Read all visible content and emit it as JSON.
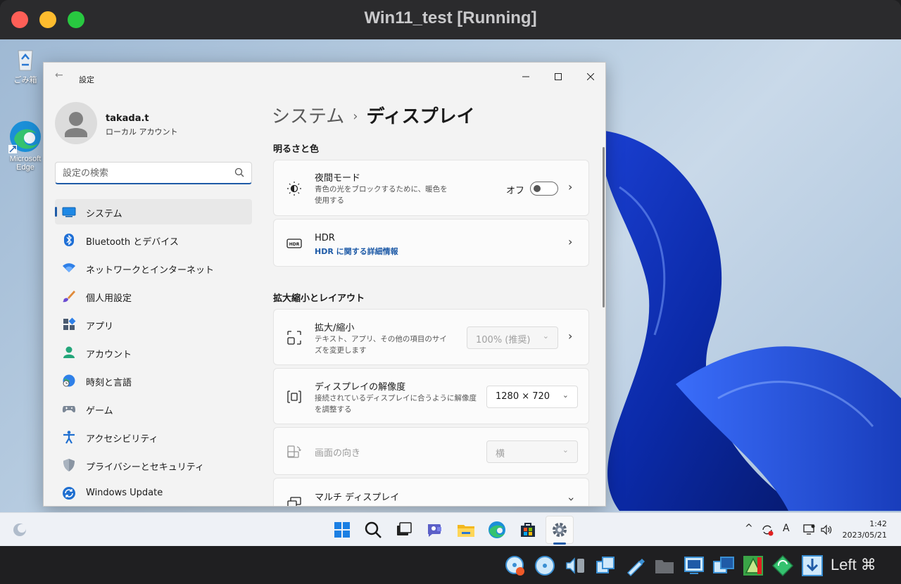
{
  "host_window": {
    "title": "Win11_test [Running]",
    "host_key_label": "Left ⌘"
  },
  "desktop": {
    "icons": [
      {
        "label": "ごみ箱",
        "icon": "recycle-bin-icon"
      },
      {
        "label": "Microsoft Edge",
        "icon": "edge-icon"
      }
    ]
  },
  "settings": {
    "window_title": "設定",
    "user": {
      "name": "takada.t",
      "account_type": "ローカル アカウント"
    },
    "search": {
      "placeholder": "設定の検索"
    },
    "nav": [
      {
        "label": "システム",
        "icon": "system-icon",
        "active": true
      },
      {
        "label": "Bluetooth とデバイス",
        "icon": "bluetooth-icon"
      },
      {
        "label": "ネットワークとインターネット",
        "icon": "wifi-icon"
      },
      {
        "label": "個人用設定",
        "icon": "brush-icon"
      },
      {
        "label": "アプリ",
        "icon": "apps-icon"
      },
      {
        "label": "アカウント",
        "icon": "account-icon"
      },
      {
        "label": "時刻と言語",
        "icon": "time-language-icon"
      },
      {
        "label": "ゲーム",
        "icon": "gamepad-icon"
      },
      {
        "label": "アクセシビリティ",
        "icon": "accessibility-icon"
      },
      {
        "label": "プライバシーとセキュリティ",
        "icon": "shield-icon"
      },
      {
        "label": "Windows Update",
        "icon": "windows-update-icon"
      }
    ],
    "breadcrumb": {
      "parent": "システム",
      "separator": "›",
      "current": "ディスプレイ"
    },
    "sections": {
      "brightness_color": "明るさと色",
      "scale_layout": "拡大縮小とレイアウト"
    },
    "night_light": {
      "title": "夜間モード",
      "description": "青色の光をブロックするために、暖色を使用する",
      "state": "オフ"
    },
    "hdr": {
      "title": "HDR",
      "link": "HDR に関する詳細情報"
    },
    "scale": {
      "title": "拡大/縮小",
      "description": "テキスト、アプリ、その他の項目のサイズを変更します",
      "value": "100% (推奨)"
    },
    "resolution": {
      "title": "ディスプレイの解像度",
      "description": "接続されているディスプレイに合うように解像度を調整する",
      "value": "1280 × 720"
    },
    "orientation": {
      "title": "画面の向き",
      "value": "横"
    },
    "multi_display": {
      "title": "マルチ ディスプレイ"
    }
  },
  "taskbar": {
    "time": "1:42",
    "date": "2023/05/21",
    "ime": "A"
  },
  "colors": {
    "accent": "#1f5ba7",
    "window_bg": "#f3f3f3",
    "card_bg": "#fbfbfb"
  }
}
